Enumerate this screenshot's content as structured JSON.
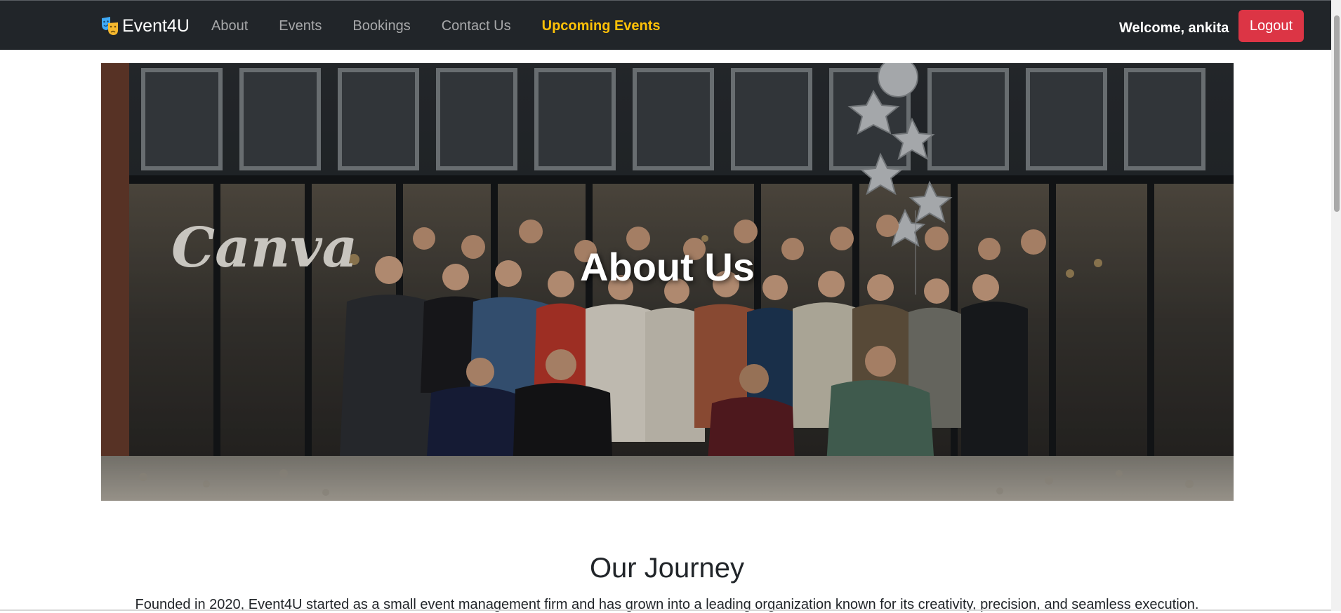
{
  "navbar": {
    "brand": "Event4U",
    "links": [
      {
        "label": "About"
      },
      {
        "label": "Events"
      },
      {
        "label": "Bookings"
      },
      {
        "label": "Contact Us"
      },
      {
        "label": "Upcoming Events"
      }
    ],
    "welcome": "Welcome, ankita",
    "logout_label": "Logout"
  },
  "hero": {
    "title": "About Us",
    "sign_text": "Canva"
  },
  "journey": {
    "title": "Our Journey",
    "text": "Founded in 2020, Event4U started as a small event management firm and has grown into a leading organization known for its creativity, precision, and seamless execution."
  },
  "colors": {
    "navbar_bg": "#212529",
    "accent": "#ffc107",
    "logout": "#dc3545"
  }
}
